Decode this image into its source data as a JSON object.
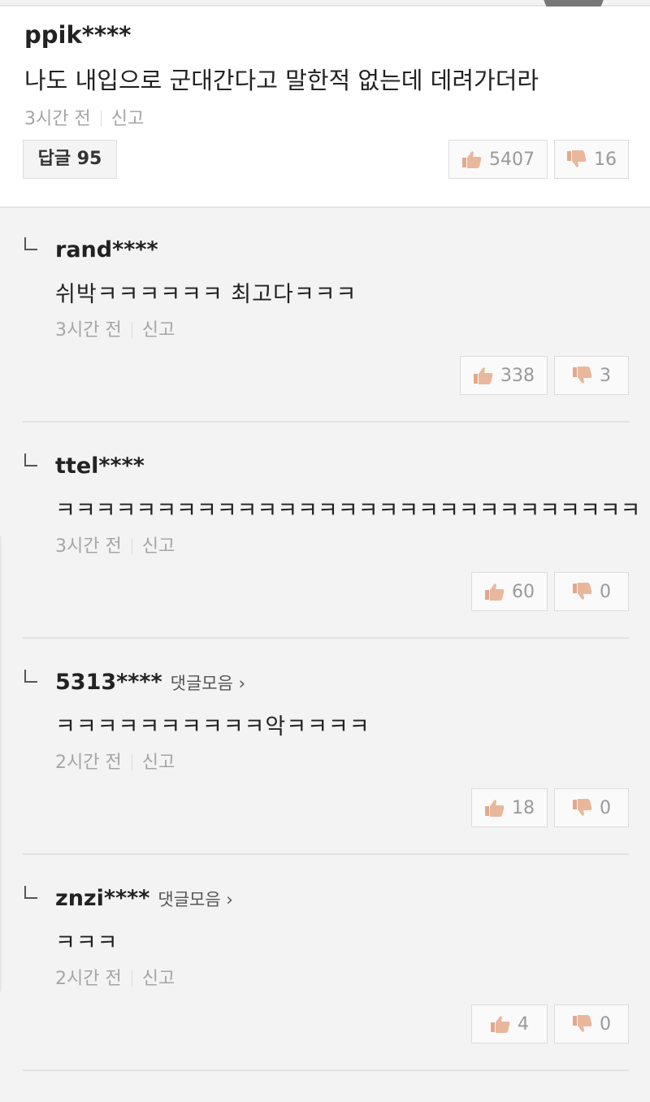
{
  "main_comment": {
    "username": "ppik****",
    "text": "나도 내입으로 군대간다고 말한적 없는데 데려가더라",
    "time": "3시간 전",
    "report": "신고",
    "reply_button": "답글 95",
    "likes": "5407",
    "dislikes": "16"
  },
  "replies": [
    {
      "username": "rand****",
      "collect": "",
      "text": "쉬박ㅋㅋㅋㅋㅋㅋ 최고다ㅋㅋㅋ",
      "time": "3시간 전",
      "report": "신고",
      "likes": "338",
      "dislikes": "3"
    },
    {
      "username": "ttel****",
      "collect": "",
      "text": "ㅋㅋㅋㅋㅋㅋㅋㅋㅋㅋㅋㅋㅋㅋㅋㅋㅋㅋㅋㅋㅋㅋㅋㅋㅋㅋㅋㅋㅋ",
      "time": "3시간 전",
      "report": "신고",
      "likes": "60",
      "dislikes": "0"
    },
    {
      "username": "5313****",
      "collect": "댓글모음 ›",
      "text": "ㅋㅋㅋㅋㅋㅋㅋㅋㅋㅋ악ㅋㅋㅋㅋ",
      "time": "2시간 전",
      "report": "신고",
      "likes": "18",
      "dislikes": "0"
    },
    {
      "username": "znzi****",
      "collect": "댓글모음 ›",
      "text": "ㅋㅋㅋ",
      "time": "2시간 전",
      "report": "신고",
      "likes": "4",
      "dislikes": "0"
    }
  ],
  "icons": {
    "like": "thumbs-up-icon",
    "dislike": "thumbs-down-icon",
    "reply_marker": "reply-corner-icon"
  },
  "colors": {
    "thumb": "#e3a88a",
    "text_muted": "#a5a5a5"
  }
}
